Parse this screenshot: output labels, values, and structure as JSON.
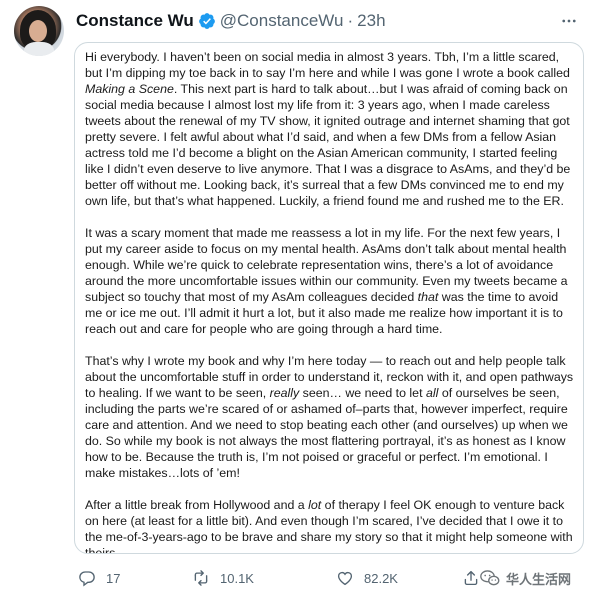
{
  "tweet": {
    "author_name": "Constance Wu",
    "handle": "@ConstanceWu",
    "separator": "·",
    "time": "23h",
    "more_glyph": "···",
    "icons": {
      "avatar": "profile-photo",
      "verified": "verified-badge-icon",
      "more": "more-icon",
      "reply": "reply-icon",
      "retweet": "retweet-icon",
      "like": "heart-icon",
      "share": "share-icon"
    },
    "colors": {
      "verified": "#1d9bf0",
      "secondary_text": "#536471",
      "border": "#cfd9de"
    },
    "paragraphs": [
      [
        {
          "text": "Hi everybody. I haven’t been on social media in almost 3 years. Tbh, I’m a little scared, but I’m dipping my toe back in to say I’m here and while I was gone I wrote a book called "
        },
        {
          "text": "Making a Scene",
          "em": true
        },
        {
          "text": ". This next part is hard to talk about…but I was afraid of coming back on social media because I almost lost my life from it: 3 years ago, when I made careless tweets about the renewal of my TV show, it ignited outrage and internet shaming that got pretty severe. I felt awful about what I’d said, and when a few DMs from a fellow Asian actress told me I’d become a blight on the Asian American community, I started feeling like I didn’t even deserve to live anymore. That I was a disgrace to AsAms, and they’d be better off without me. Looking back, it’s surreal that a few DMs convinced me to end my own life, but that’s what happened. Luckily, a friend found me and rushed me to the ER."
        }
      ],
      [
        {
          "text": "It was a scary moment that made me reassess a lot in my life. For the next few years, I put my career aside to focus on my mental health. AsAms don’t talk about mental health enough. While we’re quick to celebrate representation wins, there’s a lot of avoidance around the more uncomfortable issues within our community. Even my tweets became a subject so touchy that most of my AsAm colleagues decided "
        },
        {
          "text": "that",
          "em": true
        },
        {
          "text": " was the time to avoid me or ice me out. I’ll admit it hurt a lot, but it also made me realize how important it is to reach out and care for people who are going through a hard time."
        }
      ],
      [
        {
          "text": "That’s why I wrote my book and why I’m here today — to reach out and help people talk about the uncomfortable stuff in order to understand it, reckon with it, and open pathways to healing. If we want to be seen, "
        },
        {
          "text": "really",
          "em": true
        },
        {
          "text": " seen… we need to let "
        },
        {
          "text": "all",
          "em": true
        },
        {
          "text": " of ourselves be seen, including the parts we’re scared of or ashamed of–parts that, however imperfect, require care and attention. And we need to stop beating each other (and ourselves) up when we do. So while my book is not always the most flattering portrayal, it’s as honest as I know how to be. Because the truth is, I’m not poised or graceful or perfect. I’m emotional. I make mistakes…lots of ’em!"
        }
      ],
      [
        {
          "text": "After a little break from Hollywood and a "
        },
        {
          "text": "lot",
          "em": true
        },
        {
          "text": " of therapy I feel OK enough to venture back on here (at least for a little bit). And even though I’m scared, I’ve decided that I owe it to the me-of-3-years-ago to be brave and share my story so that it might help someone with theirs."
        }
      ]
    ],
    "counts": {
      "replies": "17",
      "retweets": "10.1K",
      "likes": "82.2K"
    },
    "watermark": "华人生活网"
  }
}
